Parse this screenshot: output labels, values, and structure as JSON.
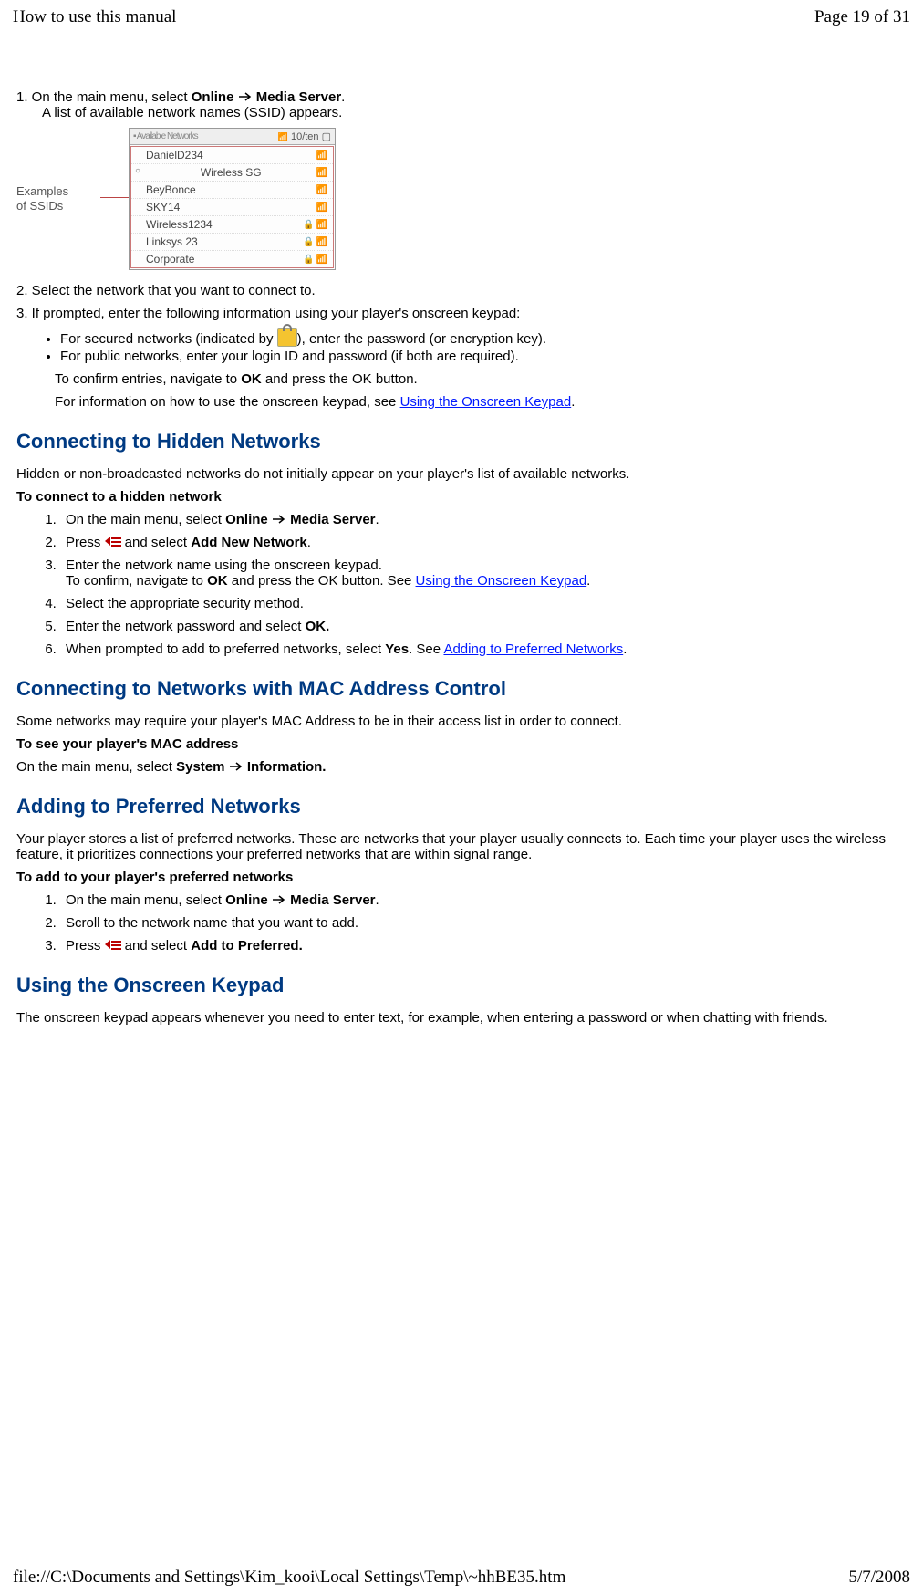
{
  "header": {
    "left": "How to use this manual",
    "right": "Page 19 of 31"
  },
  "footer": {
    "left": "file://C:\\Documents and Settings\\Kim_kooi\\Local Settings\\Temp\\~hhBE35.htm",
    "right": "5/7/2008"
  },
  "intro": {
    "step1_prefix": "1. On the main menu, select ",
    "bold_online": "Online",
    "bold_media_server": "Media Server",
    "step1_suffix": ".",
    "step1_note": "A list of available network names (SSID) appears."
  },
  "ssid_panel": {
    "label_line1": "Examples",
    "label_line2": "of SSIDs",
    "title_left": "Available Networks",
    "title_right": "10/ten",
    "rows": [
      {
        "name": "DanielD234",
        "lock": false,
        "dot": false
      },
      {
        "name": "Wireless SG",
        "lock": false,
        "dot": true
      },
      {
        "name": "BeyBonce",
        "lock": false,
        "dot": false
      },
      {
        "name": "SKY14",
        "lock": false,
        "dot": false
      },
      {
        "name": "Wireless1234",
        "lock": true,
        "dot": false
      },
      {
        "name": "Linksys 23",
        "lock": true,
        "dot": false
      },
      {
        "name": "Corporate",
        "lock": true,
        "dot": false
      }
    ]
  },
  "step2": "2. Select the network that you want to connect to.",
  "step3": {
    "lead": "3. If prompted, enter the following information using your player's onscreen keypad:",
    "b1_a": "For secured networks (indicated by ",
    "b1_b": "), enter the password (or encryption key).",
    "b2": "For public networks, enter your login ID and password (if both are required).",
    "confirm_a": "To confirm entries, navigate to ",
    "confirm_ok": "OK",
    "confirm_b": " and press the OK button.",
    "info_a": "For information on how to use the onscreen keypad, see ",
    "info_link": "Using the Onscreen Keypad",
    "info_b": "."
  },
  "hidden": {
    "title": "Connecting to Hidden Networks",
    "intro": "Hidden or non-broadcasted networks do not initially appear on your player's list of available networks.",
    "subhead": "To connect to a hidden network",
    "s1_a": "On the main menu, select ",
    "s1_b": ".",
    "s2_a": "Press ",
    "s2_b": " and select ",
    "s2_bold": "Add New Network",
    "s2_c": ".",
    "s3_a": "Enter the network name using the onscreen keypad.",
    "s3_b_a": "To confirm, navigate to ",
    "s3_ok": "OK",
    "s3_b_b": " and press the OK button. See ",
    "s3_link": "Using the Onscreen Keypad",
    "s3_b_c": ".",
    "s4": "Select the appropriate security method.",
    "s5_a": "Enter the network password and select ",
    "s5_bold": "OK.",
    "s6_a": "When prompted to add to preferred networks, select ",
    "s6_bold": "Yes",
    "s6_b": ". See ",
    "s6_link": "Adding to Preferred Networks",
    "s6_c": "."
  },
  "mac": {
    "title": "Connecting to Networks with MAC Address Control",
    "intro": "Some networks may require your player's MAC Address to be in their access list in order to connect.",
    "subhead": "To see your player's MAC address",
    "line_a": "On the main menu, select ",
    "sys": "System",
    "info": "Information."
  },
  "pref": {
    "title": "Adding to Preferred Networks",
    "intro": "Your player stores a list of preferred networks. These are networks that your player usually connects to. Each time your player uses the wireless feature, it prioritizes connections your preferred networks that are within signal range.",
    "subhead": "To add to your player's preferred networks",
    "s1_a": "On the main menu, select ",
    "s1_b": ".",
    "s2": "Scroll to the network name that you want to add.",
    "s3_a": "Press ",
    "s3_b": " and select ",
    "s3_bold": "Add to Preferred."
  },
  "keypad": {
    "title": "Using the Onscreen Keypad",
    "intro": "The onscreen keypad appears whenever you need to enter text, for example, when entering a password or when chatting with friends."
  }
}
